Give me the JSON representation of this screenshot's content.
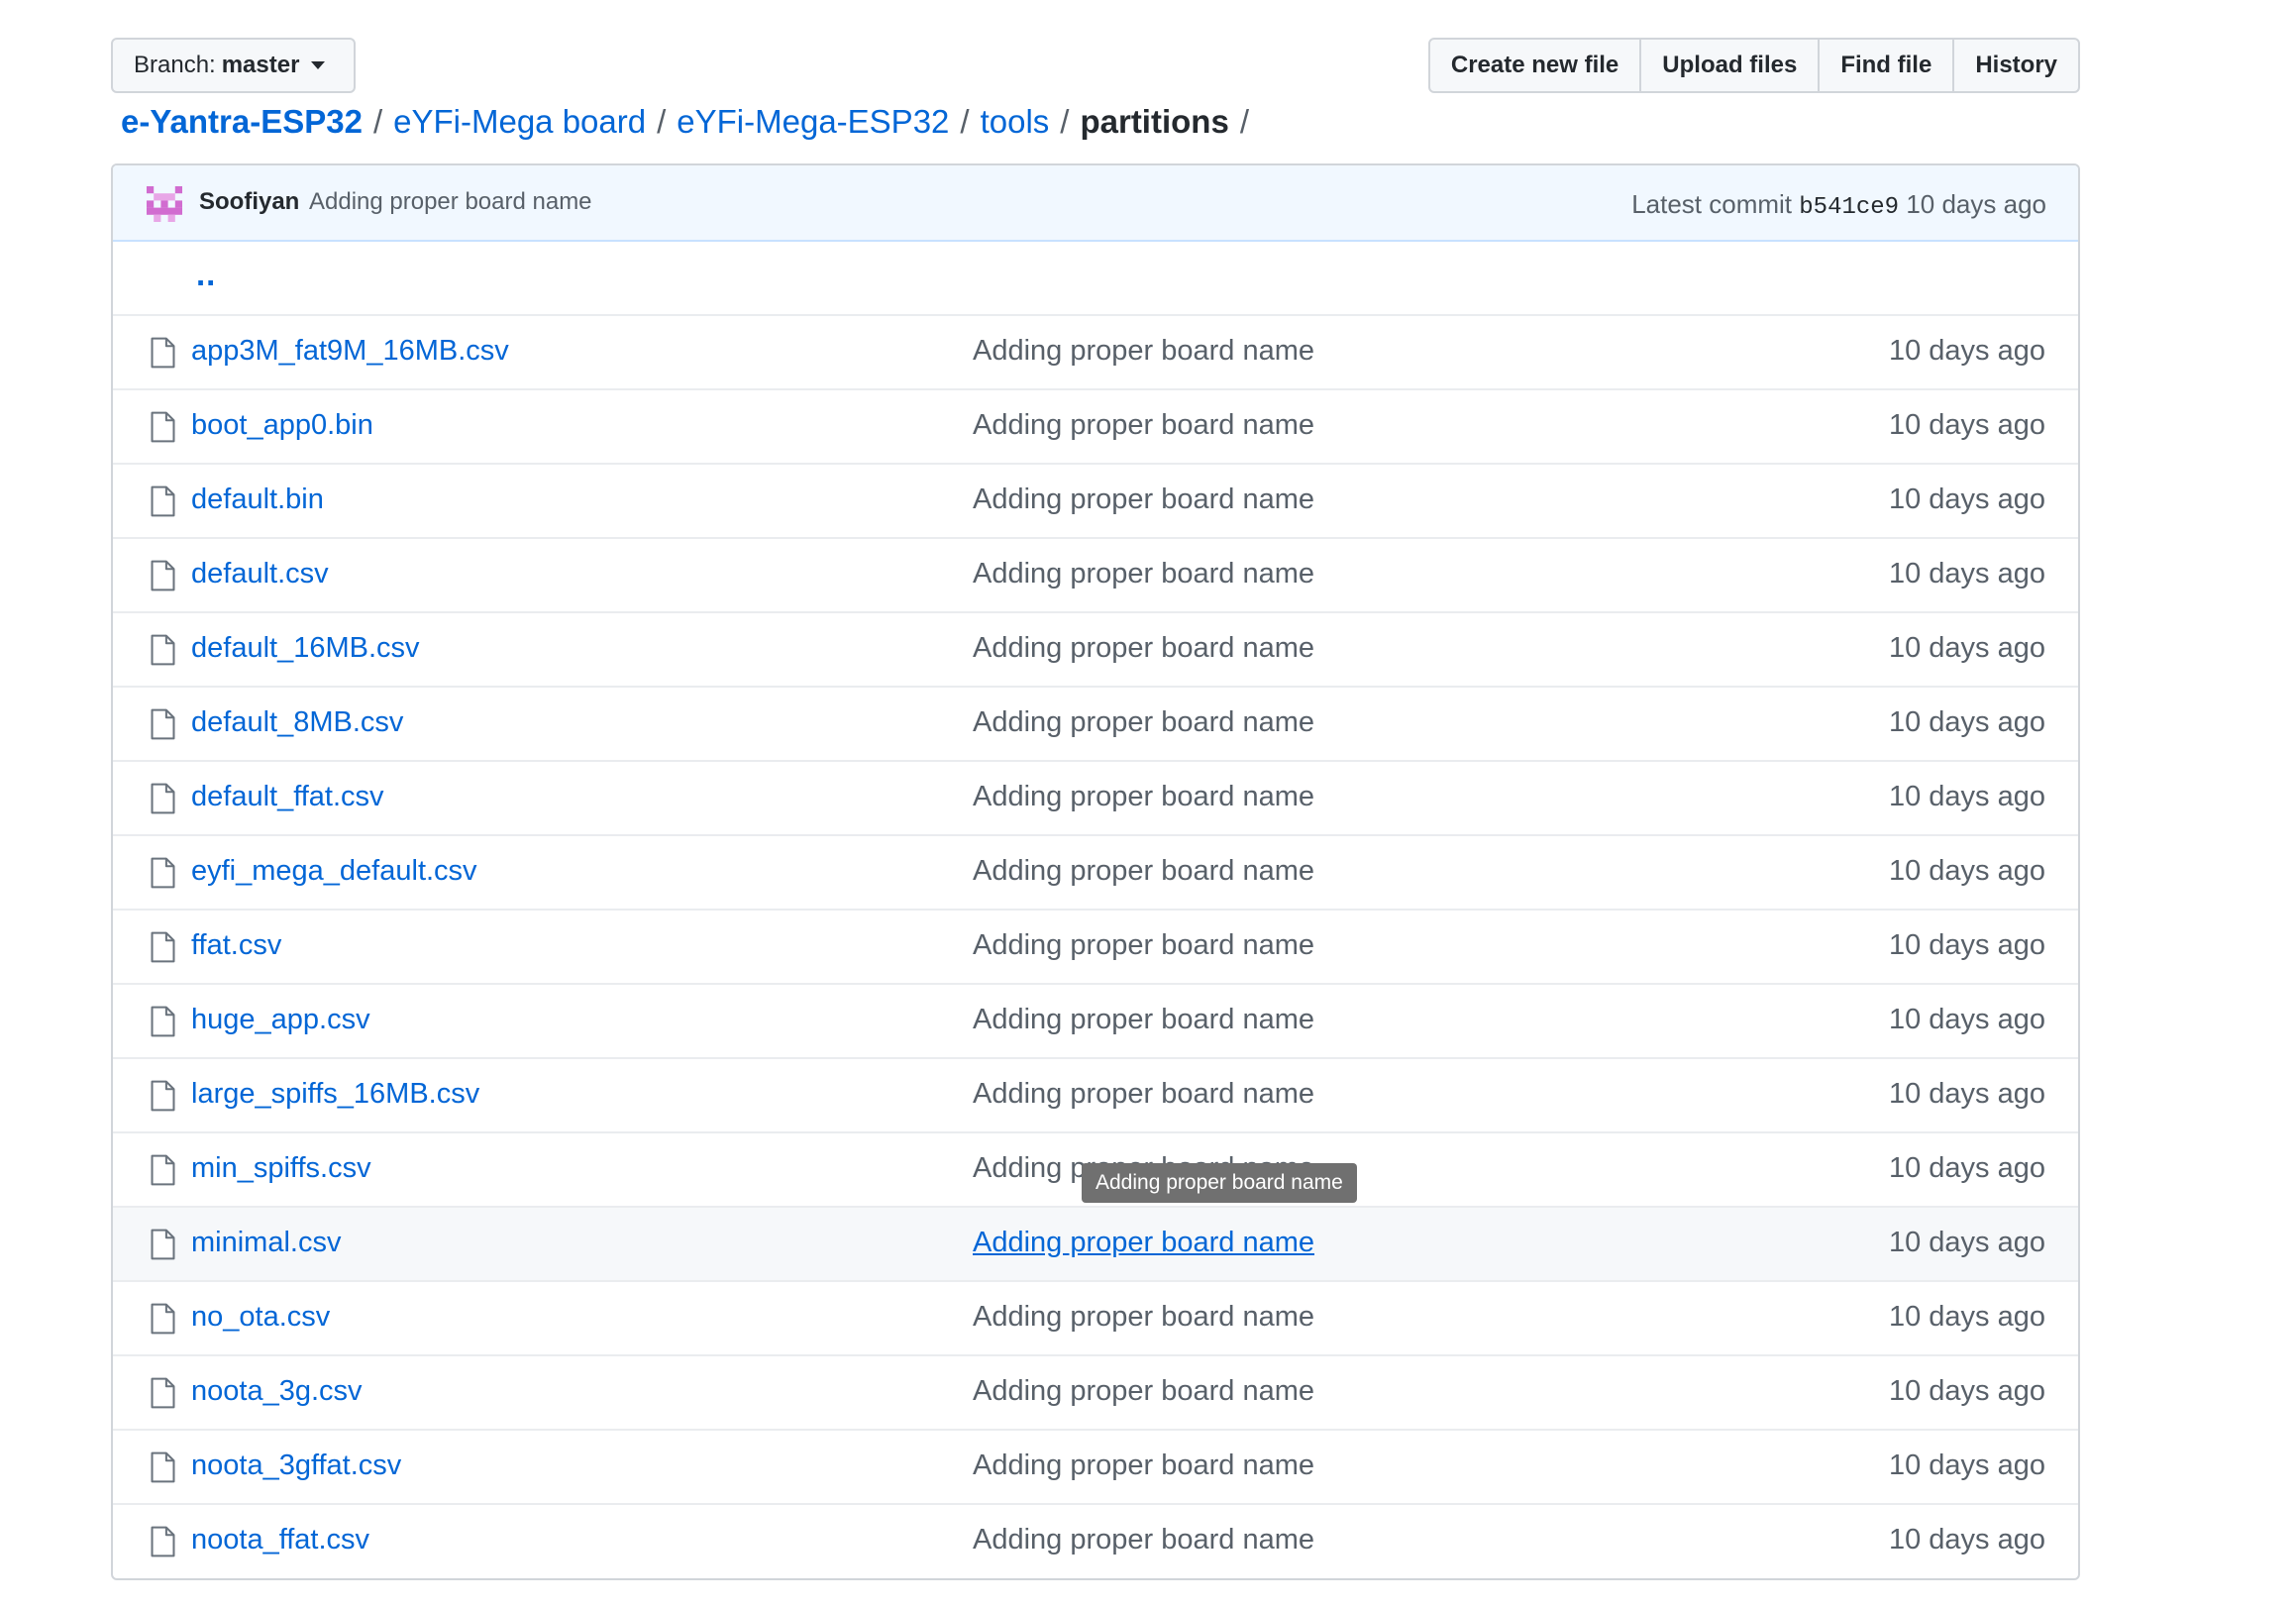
{
  "branch": {
    "label": "Branch:",
    "value": "master"
  },
  "actions": {
    "create": "Create new file",
    "upload": "Upload files",
    "find": "Find file",
    "history": "History"
  },
  "breadcrumb": {
    "root": "e-Yantra-ESP32",
    "items": [
      "eYFi-Mega board",
      "eYFi-Mega-ESP32",
      "tools"
    ],
    "current": "partitions",
    "separator": "/"
  },
  "commit": {
    "author": "Soofiyan",
    "message": "Adding proper board name",
    "latest_label": "Latest commit",
    "sha": "b541ce9",
    "age": "10 days ago"
  },
  "parent_dir": "..",
  "files": [
    {
      "name": "app3M_fat9M_16MB.csv",
      "message": "Adding proper board name",
      "age": "10 days ago"
    },
    {
      "name": "boot_app0.bin",
      "message": "Adding proper board name",
      "age": "10 days ago"
    },
    {
      "name": "default.bin",
      "message": "Adding proper board name",
      "age": "10 days ago"
    },
    {
      "name": "default.csv",
      "message": "Adding proper board name",
      "age": "10 days ago"
    },
    {
      "name": "default_16MB.csv",
      "message": "Adding proper board name",
      "age": "10 days ago"
    },
    {
      "name": "default_8MB.csv",
      "message": "Adding proper board name",
      "age": "10 days ago"
    },
    {
      "name": "default_ffat.csv",
      "message": "Adding proper board name",
      "age": "10 days ago"
    },
    {
      "name": "eyfi_mega_default.csv",
      "message": "Adding proper board name",
      "age": "10 days ago"
    },
    {
      "name": "ffat.csv",
      "message": "Adding proper board name",
      "age": "10 days ago"
    },
    {
      "name": "huge_app.csv",
      "message": "Adding proper board name",
      "age": "10 days ago"
    },
    {
      "name": "large_spiffs_16MB.csv",
      "message": "Adding proper board name",
      "age": "10 days ago"
    },
    {
      "name": "min_spiffs.csv",
      "message": "Adding proper board name",
      "age": "10 days ago"
    },
    {
      "name": "minimal.csv",
      "message": "Adding proper board name",
      "age": "10 days ago"
    },
    {
      "name": "no_ota.csv",
      "message": "Adding proper board name",
      "age": "10 days ago"
    },
    {
      "name": "noota_3g.csv",
      "message": "Adding proper board name",
      "age": "10 days ago"
    },
    {
      "name": "noota_3gffat.csv",
      "message": "Adding proper board name",
      "age": "10 days ago"
    },
    {
      "name": "noota_ffat.csv",
      "message": "Adding proper board name",
      "age": "10 days ago"
    }
  ],
  "tooltip": "Adding proper board name",
  "colors": {
    "link": "#0366d6",
    "muted": "#586069",
    "commit_bar_bg": "#f1f8ff",
    "avatar": "#d16cd0"
  },
  "icons": {
    "file": "file-icon",
    "caret": "caret-down-icon",
    "avatar": "identicon-avatar"
  }
}
